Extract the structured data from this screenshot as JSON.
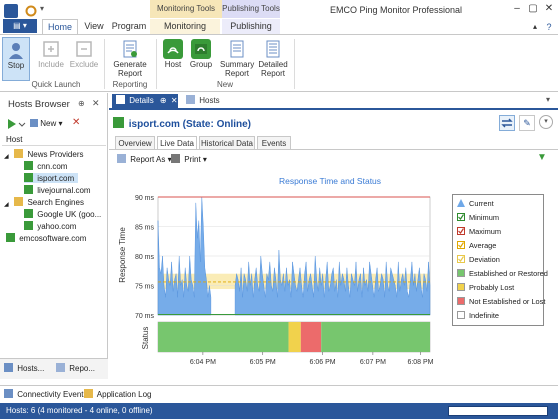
{
  "titlebar": {
    "app_title": "EMCO Ping Monitor Professional",
    "context_monitoring": "Monitoring Tools",
    "context_publishing": "Publishing Tools",
    "file_label": "▤ ▾"
  },
  "ribbon_tabs": [
    "Home",
    "View",
    "Program",
    "Monitoring",
    "Publishing"
  ],
  "ribbon": {
    "stop": "Stop",
    "include": "Include",
    "exclude": "Exclude",
    "generate_report_1": "Generate",
    "generate_report_2": "Report",
    "host": "Host",
    "group": "Group",
    "summary_report_1": "Summary",
    "summary_report_2": "Report",
    "detailed_report_1": "Detailed",
    "detailed_report_2": "Report",
    "group_quick_launch": "Quick Launch",
    "group_reporting": "Reporting",
    "group_new": "New"
  },
  "hosts_browser": {
    "title": "Hosts Browser",
    "new_label": "New",
    "column_header": "Host",
    "tree": [
      {
        "label": "News Providers",
        "kind": "group",
        "level": 0
      },
      {
        "label": "cnn.com",
        "kind": "host",
        "level": 1
      },
      {
        "label": "isport.com",
        "kind": "host",
        "level": 1,
        "selected": true
      },
      {
        "label": "livejournal.com",
        "kind": "host",
        "level": 1
      },
      {
        "label": "Search Engines",
        "kind": "group",
        "level": 0
      },
      {
        "label": "Google UK (goo...",
        "kind": "host",
        "level": 1
      },
      {
        "label": "yahoo.com",
        "kind": "host",
        "level": 1
      },
      {
        "label": "emcosoftware.com",
        "kind": "host",
        "level": 0
      }
    ],
    "bottom_tabs": [
      "Hosts...",
      "Repo..."
    ]
  },
  "doc_tabs": [
    {
      "label": "Details",
      "active": true
    },
    {
      "label": "Hosts",
      "active": false
    }
  ],
  "details": {
    "header": "isport.com (State: Online)",
    "subtabs": [
      "Overview",
      "Live Data",
      "Historical Data",
      "Events"
    ],
    "active_subtab": "Live Data",
    "report_as": "Report As",
    "print": "Print"
  },
  "chart_data": {
    "type": "area",
    "title": "Response Time and Status",
    "ylabel": "Response Time",
    "status_label": "Status",
    "ylim": [
      70,
      90
    ],
    "y_ticks": [
      "90 ms",
      "85 ms",
      "80 ms",
      "75 ms",
      "70 ms"
    ],
    "x_ticks": [
      "6:04 PM",
      "6:05 PM",
      "6:06 PM",
      "6:07 PM",
      "6:08 PM"
    ],
    "minimum": 70,
    "maximum": 90,
    "average": 75.6,
    "deviation_band": [
      74.4,
      77.0
    ],
    "series": [
      {
        "name": "Current",
        "values": [
          86,
          78,
          77,
          80,
          75,
          73,
          78,
          76,
          75,
          79,
          74,
          76,
          77,
          73,
          80,
          75,
          76,
          73,
          78,
          75,
          74,
          80,
          76,
          75,
          73,
          89,
          83,
          86,
          79,
          90,
          85,
          78,
          76,
          73,
          75,
          73,
          null,
          null,
          null,
          null,
          null,
          null,
          null,
          null,
          null,
          null,
          null,
          null,
          null,
          null,
          null,
          75,
          77,
          76,
          74,
          78,
          73,
          77,
          76,
          74,
          79,
          75,
          77,
          73,
          76,
          78,
          75,
          74,
          80,
          77,
          75,
          73,
          77,
          76,
          79,
          75,
          74,
          78,
          76,
          73,
          81,
          76,
          75,
          77,
          74,
          78,
          75,
          76,
          73,
          79,
          77,
          75,
          74,
          76,
          78,
          75,
          73,
          77,
          79,
          74,
          76,
          77,
          75,
          73,
          80,
          76,
          74,
          78,
          75,
          77,
          73,
          76,
          79,
          74,
          75,
          77,
          78,
          74,
          76,
          73,
          79,
          75,
          77,
          76,
          74,
          78,
          75,
          73,
          77,
          76,
          75,
          79,
          74,
          76,
          77,
          73,
          78,
          75,
          76,
          74,
          79,
          77,
          75,
          73,
          76,
          78,
          74,
          75,
          77,
          76,
          73,
          79,
          75,
          74,
          78,
          77,
          76,
          75,
          73,
          79,
          74,
          76,
          77,
          75,
          78,
          74,
          73,
          76,
          79,
          75,
          77,
          74,
          76,
          78,
          75,
          73,
          77,
          76,
          74,
          79,
          75
        ]
      }
    ],
    "status_segments": [
      {
        "from": 0,
        "to": 0.48,
        "status": "Established or Restored"
      },
      {
        "from": 0.48,
        "to": 0.525,
        "status": "Probably Lost"
      },
      {
        "from": 0.525,
        "to": 0.6,
        "status": "Not Established or Lost"
      },
      {
        "from": 0.6,
        "to": 1.0,
        "status": "Established or Restored"
      }
    ],
    "legend": [
      {
        "label": "Current",
        "color": "#6fa8e8",
        "kind": "triangle"
      },
      {
        "label": "Minimum",
        "color": "#2e8b2e",
        "kind": "check"
      },
      {
        "label": "Maximum",
        "color": "#c0392b",
        "kind": "check"
      },
      {
        "label": "Average",
        "color": "#e0a800",
        "kind": "check"
      },
      {
        "label": "Deviation",
        "color": "#e8c84a",
        "kind": "check"
      },
      {
        "label": "Established or Restored",
        "color": "#77c66e",
        "kind": "box"
      },
      {
        "label": "Probably Lost",
        "color": "#f1d24c",
        "kind": "box"
      },
      {
        "label": "Not Established or Lost",
        "color": "#ec6b6b",
        "kind": "box"
      },
      {
        "label": "Indefinite",
        "color": "#ffffff",
        "kind": "box"
      }
    ]
  },
  "bottom_bar": {
    "connectivity_events": "Connectivity Events",
    "application_log": "Application Log"
  },
  "statusbar": {
    "text": "Hosts: 6 (4 monitored - 4 online, 0 offline)"
  },
  "colors": {
    "accent": "#2b579a",
    "online_text": "#1e4f9c",
    "chart_fill": "#6fa8e8",
    "max_line": "#d9534f",
    "min_line": "#3a9a3a",
    "avg_line": "#e0a800",
    "dev_band": "#f5dc7a"
  }
}
